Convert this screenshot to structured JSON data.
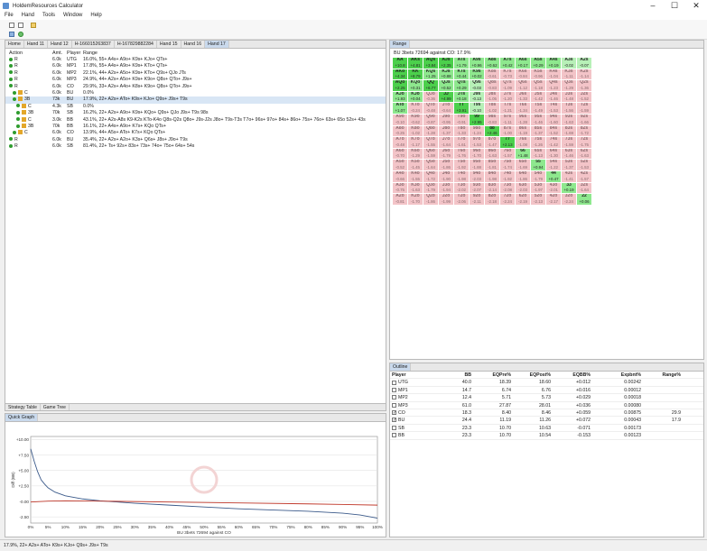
{
  "app": {
    "title": "HoldemResources Calculator"
  },
  "window_controls": [
    "–",
    "☐",
    "✕"
  ],
  "menu": [
    "File",
    "Hand",
    "Tools",
    "Window",
    "Help"
  ],
  "tabs": [
    "Home",
    "Hand 11",
    "Hand 12",
    "H-166015263837",
    "H-167829882284",
    "Hand 15",
    "Hand 16",
    "Hand 17"
  ],
  "active_tab": "Hand 17",
  "strategy": {
    "headers": {
      "action": "Action",
      "amt": "Amt.",
      "player": "Player",
      "range": "Range"
    },
    "rows": [
      {
        "action": "R",
        "amt": "6.0k",
        "player": "UTG",
        "range": "16.0%, 55+ A4s+ A9o+ K9s+ KJo+ QTs+"
      },
      {
        "action": "R",
        "amt": "6.0k",
        "player": "MP1",
        "range": "17.8%, 55+ A4s+ A9o+ K9s+ KTo+ QTs+"
      },
      {
        "action": "R",
        "amt": "6.0k",
        "player": "MP2",
        "range": "22.1%, 44+ A2s+ A5o+ K9s+ KTo+ Q9s+ QJo JTs"
      },
      {
        "action": "R",
        "amt": "6.0k",
        "player": "MP3",
        "range": "24.9%, 44+ A2s+ A5o+ K9s+ K9o+ Q8s+ QTo+ J9s+"
      },
      {
        "action": "R",
        "amt": "6.0k",
        "player": "CO",
        "range": "29.9%, 33+ A2s+ A4o+ K8s+ K9o+ Q8s+ QTo+ J9s+"
      },
      {
        "action": "C",
        "amt": "6.0k",
        "player": "BU",
        "range": "0.0%"
      },
      {
        "action": "3B",
        "amt": "73k",
        "player": "BU",
        "range": "17.9%, 22+ A2s+ ATo+ K9s+ KJo+ Q9s+ J9s+ T9s",
        "selected": true
      },
      {
        "action": "C",
        "amt": "4.3k",
        "player": "SB",
        "range": "0.0%"
      },
      {
        "action": "3B",
        "amt": "70k",
        "player": "SB",
        "range": "16.2%, 22+ A2s+ A9o+ K9s+ KQo+ Q9s+ QJo J9s+ T9s 98s"
      },
      {
        "action": "C",
        "amt": "3.0k",
        "player": "BB",
        "range": "43.1%, 22+ A2s-A8s K9-K2s KTo-K4o Q8s-Q2s Q8o+ J9s-J2s J8o+ T9s-T3s T7o+ 96s+ 97o+ 84s+ 86o+ 75s+ 76o+ 63s+ 65o 52s+ 43s"
      },
      {
        "action": "3B",
        "amt": "70k",
        "player": "BB",
        "range": "16.1%, 22+ A4s+ A9o+ K7s+ KQo QTs+"
      },
      {
        "action": "C",
        "amt": "6.0k",
        "player": "CO",
        "range": "13.9%, 44+ A5s+ ATo+ K7s+ KQo QTs+"
      },
      {
        "action": "R",
        "amt": "6.0k",
        "player": "BU",
        "range": "35.4%, 22+ A2s+ A2o+ K3s+ Q6s+ J8s+ J9o+ T9s"
      },
      {
        "action": "R",
        "amt": "6.0k",
        "player": "SB",
        "range": "81.4%, 22+ Ts+ 92s+ 83s+ 73s+ 74o+ 75o+ 64s+ 54s"
      }
    ],
    "bottom_tabs": [
      "Strategy Table",
      "Game Tree"
    ]
  },
  "quick_graph": {
    "title": "Quick Graph",
    "chart_data": {
      "type": "line",
      "xlabel": "BU 3bets 72694 against CO",
      "ylabel": "Diff (BB)",
      "ylim": [
        -3.5,
        10.5
      ],
      "yticks": [
        10,
        7.5,
        5,
        2.5,
        0,
        -2.5
      ],
      "ytick_labels": [
        "+10.00",
        "+7.50",
        "+5.00",
        "+2.50",
        "-0.00",
        "-2.50"
      ],
      "xticks": [
        "0%",
        "5%",
        "10%",
        "15%",
        "20%",
        "25%",
        "30%",
        "35%",
        "40%",
        "45%",
        "50%",
        "55%",
        "60%",
        "65%",
        "70%",
        "75%",
        "80%",
        "85%",
        "90%",
        "95%",
        "100%"
      ],
      "series": [
        {
          "color": "#3b5a8a",
          "x": [
            0,
            1,
            2,
            3,
            4,
            5,
            7,
            10,
            15,
            20,
            30,
            40,
            50,
            60,
            70,
            80,
            90,
            95,
            100
          ],
          "values": [
            8.5,
            6.5,
            4.8,
            3.5,
            2.8,
            2.2,
            1.5,
            0.9,
            0.4,
            0.1,
            -0.3,
            -0.6,
            -0.9,
            -1.2,
            -1.4,
            -1.6,
            -1.9,
            -2.2,
            -2.7
          ]
        },
        {
          "color": "#c0392b",
          "x": [
            0,
            5,
            10,
            20,
            40,
            60,
            80,
            100
          ],
          "values": [
            -0.1,
            0.05,
            0.1,
            0.05,
            -0.1,
            -0.25,
            -0.4,
            -0.6
          ]
        }
      ]
    }
  },
  "range_panel": {
    "title": "Range",
    "subtitle": "BU 3bets 72694 against CO: 17.9%",
    "cells": [
      [
        "AA|+10.8",
        "AKs|+4.81",
        "AQs|+3.84",
        "AJs|+2.35",
        "ATs|+1.79",
        "A9s|+0.96",
        "A8s|+0.62",
        "A7s|+0.42",
        "A6s|+0.17",
        "A5s|+0.29",
        "A4s|+0.19",
        "A3s|-0.02",
        "A2s|-0.07"
      ],
      [
        "AKo|+4.34",
        "KK|+8.79",
        "KQs|+1.25",
        "KJs|+0.88",
        "KTs|+0.44",
        "K9s|+0.02",
        "K8s|-0.61",
        "K7s|-0.73",
        "K6s|-0.84",
        "K5s|-0.96",
        "K4s|-1.04",
        "K3s|-1.11",
        "K2s|-1.14"
      ],
      [
        "AQo|+2.25",
        "KQo|+0.31",
        "QQ|+6.77",
        "QJs|+0.52",
        "QTs|+0.29",
        "Q9s|-0.03",
        "Q8s|-0.83",
        "Q7s|-1.09",
        "Q6s|-1.12",
        "Q5s|-1.18",
        "Q4s|-1.23",
        "Q3s|-1.29",
        "Q2s|-1.36"
      ],
      [
        "AJo|+1.93",
        "KJo|+0.04",
        "QJo|-0.36",
        "JJ|+4.99",
        "JTs|+0.18",
        "J9s|-0.13",
        "J8s|-1.05",
        "J7s|-1.20",
        "J6s|-1.33",
        "J5s|-1.42",
        "J4s|-1.46",
        "J3s|-1.48",
        "J2s|-1.52"
      ],
      [
        "ATo|+1.07",
        "KTo|-0.24",
        "QTo|-0.48",
        "JTo|-0.64",
        "TT|+3.91",
        "T9s|-0.10",
        "T8s|-1.02",
        "T7s|-1.21",
        "T6s|-1.34",
        "T5s|-1.49",
        "T4s|-1.53",
        "T3s|-1.56",
        "T2s|-1.59"
      ],
      [
        "A9o|-0.10",
        "K9o|-0.62",
        "Q9o|-0.87",
        "J9o|-0.95",
        "T9o|-0.91",
        "99|+2.95",
        "98s|-0.83",
        "97s|-1.11",
        "96s|-1.28",
        "95s|-1.46",
        "94s|-1.60",
        "93s|-1.63",
        "92s|-1.66"
      ],
      [
        "A8o|-0.25",
        "K8o|-1.02",
        "Q8o|-1.28",
        "J8o|-1.37",
        "T8o|-1.33",
        "98o|-1.24",
        "88|+2.46",
        "87s|-1.00",
        "86s|-1.19",
        "85s|-1.37",
        "84s|-1.52",
        "83s|-1.69",
        "82s|-1.72"
      ],
      [
        "A7o|-0.48",
        "K7o|-1.17",
        "Q7o|-1.55",
        "J7o|-1.64",
        "T7o|-1.61",
        "97o|-1.53",
        "87o|-1.47",
        "77|+2.13",
        "76s|-1.08",
        "75s|-1.26",
        "74s|-1.42",
        "73s|-1.59",
        "72s|-1.75"
      ],
      [
        "A6o|-0.70",
        "K6o|-1.29",
        "Q6o|-1.59",
        "J6o|-1.79",
        "T6o|-1.76",
        "96o|-1.70",
        "86o|-1.63",
        "76o|-1.57",
        "66|+1.48",
        "65s|-1.13",
        "64s|-1.30",
        "63s|-1.46",
        "62s|-1.63"
      ],
      [
        "A5o|-0.52",
        "K5o|-1.45",
        "Q5o|-1.64",
        "J5o|-1.86",
        "T5o|-1.92",
        "95o|-1.88",
        "85o|-1.81",
        "75o|-1.74",
        "65o|-1.69",
        "55|+0.94",
        "54s|-1.22",
        "53s|-1.37",
        "52s|-1.53"
      ],
      [
        "A4o|-0.66",
        "K4o|-1.55",
        "Q4o|-1.72",
        "J4o|-1.90",
        "T4o|-1.98",
        "94o|-2.03",
        "84o|-1.98",
        "74o|-1.92",
        "64o|-1.86",
        "54o|-1.79",
        "44|+0.47",
        "43s|-1.41",
        "42s|-1.57"
      ],
      [
        "A3o|-0.75",
        "K3o|-1.63",
        "Q3o|-1.79",
        "J3o|-1.94",
        "T3o|-2.02",
        "93o|-2.07",
        "83o|-2.14",
        "73o|-2.08",
        "63o|-2.03",
        "53o|-1.97",
        "43o|-2.01",
        "33|+0.19",
        "32s|-1.64"
      ],
      [
        "A2o|-0.81",
        "K2o|-1.70",
        "Q2o|-1.86",
        "J2o|-1.99",
        "T2o|-2.06",
        "92o|-2.11",
        "82o|-2.18",
        "72o|-2.24",
        "62o|-2.19",
        "52o|-2.13",
        "42o|-2.17",
        "32o|-2.24",
        "22|+0.06"
      ]
    ],
    "in_range": [
      [
        1,
        1,
        1,
        1,
        1,
        1,
        1,
        1,
        1,
        1,
        1,
        1,
        1
      ],
      [
        1,
        1,
        1,
        1,
        1,
        1,
        0,
        0,
        0,
        0,
        0,
        0,
        0
      ],
      [
        1,
        1,
        1,
        1,
        1,
        1,
        0,
        0,
        0,
        0,
        0,
        0,
        0
      ],
      [
        1,
        1,
        0,
        1,
        1,
        1,
        0,
        0,
        0,
        0,
        0,
        0,
        0
      ],
      [
        1,
        0,
        0,
        0,
        1,
        1,
        0,
        0,
        0,
        0,
        0,
        0,
        0
      ],
      [
        0,
        0,
        0,
        0,
        0,
        1,
        0,
        0,
        0,
        0,
        0,
        0,
        0
      ],
      [
        0,
        0,
        0,
        0,
        0,
        0,
        1,
        0,
        0,
        0,
        0,
        0,
        0
      ],
      [
        0,
        0,
        0,
        0,
        0,
        0,
        0,
        1,
        0,
        0,
        0,
        0,
        0
      ],
      [
        0,
        0,
        0,
        0,
        0,
        0,
        0,
        0,
        1,
        0,
        0,
        0,
        0
      ],
      [
        0,
        0,
        0,
        0,
        0,
        0,
        0,
        0,
        0,
        1,
        0,
        0,
        0
      ],
      [
        0,
        0,
        0,
        0,
        0,
        0,
        0,
        0,
        0,
        0,
        1,
        0,
        0
      ],
      [
        0,
        0,
        0,
        0,
        0,
        0,
        0,
        0,
        0,
        0,
        0,
        1,
        0
      ],
      [
        0,
        0,
        0,
        0,
        0,
        0,
        0,
        0,
        0,
        0,
        0,
        0,
        1
      ]
    ]
  },
  "outline": {
    "title": "Outline",
    "headers": [
      "Player",
      "BB",
      "EQPre%",
      "EQPost%",
      "EQBB%",
      "Expbnt%",
      "Range%"
    ],
    "rows": [
      {
        "player": "UTG",
        "checked": false,
        "bb": "40.0",
        "eqpre": "18.39",
        "eqpost": "18.60",
        "eqbb": "+0.012",
        "exp": "0.00242",
        "range": ""
      },
      {
        "player": "MP1",
        "checked": false,
        "bb": "14.7",
        "eqpre": "6.74",
        "eqpost": "6.76",
        "eqbb": "+0.016",
        "exp": "0.00012",
        "range": ""
      },
      {
        "player": "MP2",
        "checked": false,
        "bb": "12.4",
        "eqpre": "5.71",
        "eqpost": "5.73",
        "eqbb": "+0.029",
        "exp": "0.00018",
        "range": ""
      },
      {
        "player": "MP3",
        "checked": false,
        "bb": "61.0",
        "eqpre": "27.87",
        "eqpost": "28.01",
        "eqbb": "+0.036",
        "exp": "0.00080",
        "range": ""
      },
      {
        "player": "CO",
        "checked": true,
        "bb": "18.3",
        "eqpre": "8.40",
        "eqpost": "8.46",
        "eqbb": "+0.059",
        "exp": "0.00875",
        "range": "29.9"
      },
      {
        "player": "BU",
        "checked": true,
        "bb": "24.4",
        "eqpre": "11.19",
        "eqpost": "11.26",
        "eqbb": "+0.072",
        "exp": "0.00043",
        "range": "17.9"
      },
      {
        "player": "SB",
        "checked": false,
        "bb": "23.3",
        "eqpre": "10.70",
        "eqpost": "10.63",
        "eqbb": "-0.071",
        "exp": "0.00173",
        "range": ""
      },
      {
        "player": "BB",
        "checked": false,
        "bb": "23.3",
        "eqpre": "10.70",
        "eqpost": "10.54",
        "eqbb": "-0.153",
        "exp": "0.00123",
        "range": ""
      }
    ]
  },
  "status": "17.9%, 22+ A2s+ ATo+ K9s+ KJo+ Q9s+ J9s+ T9s"
}
